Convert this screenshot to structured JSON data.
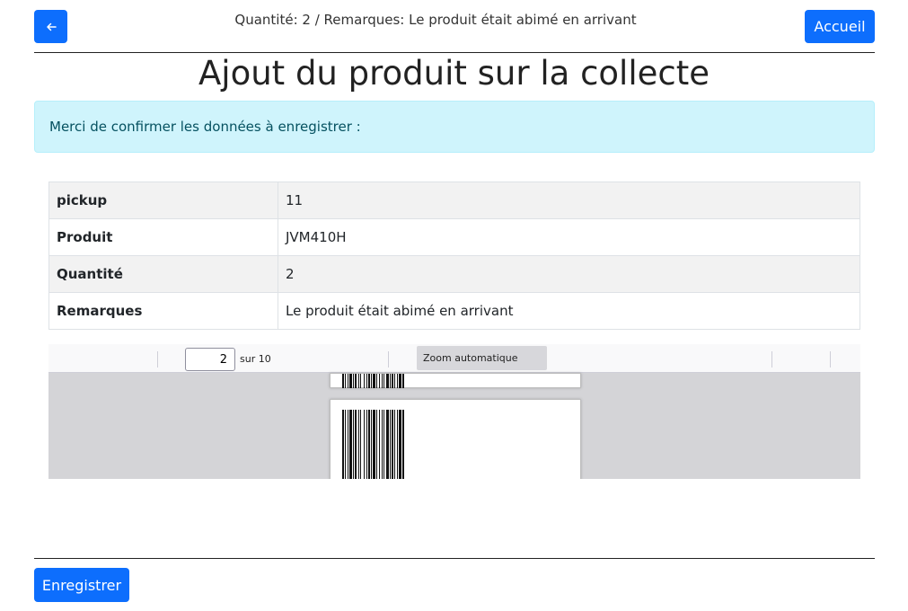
{
  "header": {
    "back_icon": "arrow-left-icon",
    "info": "Quantité: 2 / Remarques: Le produit était abimé en arrivant",
    "home_label": "Accueil"
  },
  "title": "Ajout du produit sur la collecte",
  "alert": "Merci de confirmer les données à enregistrer :",
  "table": {
    "rows": [
      {
        "key": "pickup",
        "value": "11"
      },
      {
        "key": "Produit",
        "value": "JVM410H"
      },
      {
        "key": "Quantité",
        "value": "2"
      },
      {
        "key": "Remarques",
        "value": "Le produit était abimé en arrivant"
      }
    ]
  },
  "viewer": {
    "page_number": "2",
    "page_count": "sur 10",
    "zoom": "Zoom automatique"
  },
  "footer": {
    "save_label": "Enregistrer"
  },
  "colors": {
    "primary": "#0d6efd",
    "alert_bg": "#cff4fc",
    "alert_text": "#055160"
  }
}
